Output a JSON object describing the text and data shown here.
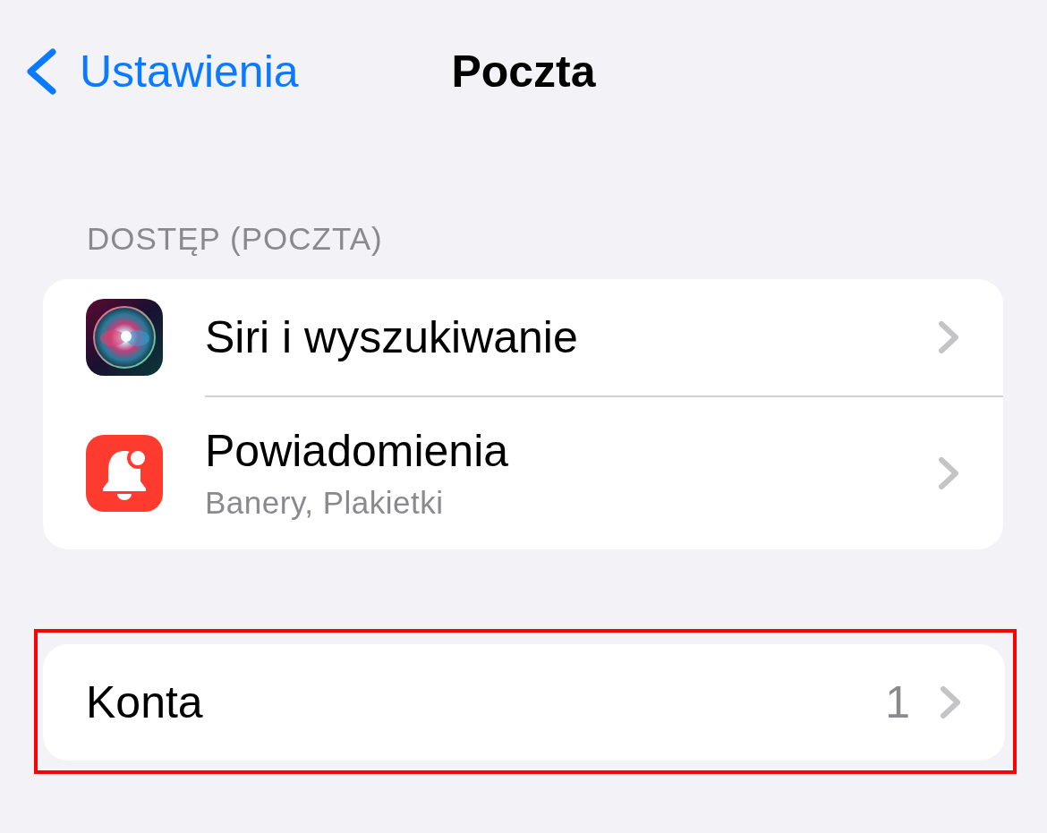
{
  "nav": {
    "back_label": "Ustawienia",
    "title": "Poczta"
  },
  "sections": [
    {
      "header": "DOSTĘP (POCZTA)",
      "highlighted": false,
      "rows": [
        {
          "kind": "siri",
          "title": "Siri i wyszukiwanie"
        },
        {
          "kind": "notifications",
          "title": "Powiadomienia",
          "subtitle": "Banery, Plakietki"
        }
      ]
    },
    {
      "highlighted": true,
      "rows": [
        {
          "kind": "plain",
          "title": "Konta",
          "value": "1"
        }
      ]
    }
  ]
}
